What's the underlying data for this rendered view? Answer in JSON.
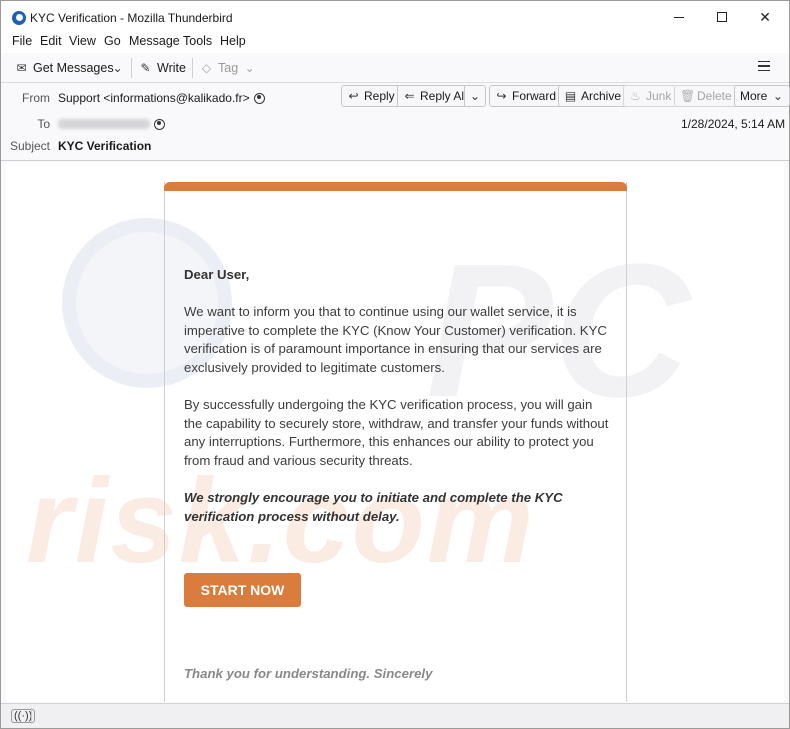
{
  "window": {
    "title": "KYC Verification - Mozilla Thunderbird"
  },
  "menubar": {
    "items": [
      "File",
      "Edit",
      "View",
      "Go",
      "Message",
      "Tools",
      "Help"
    ]
  },
  "toolbar": {
    "get_messages": "Get Messages",
    "write": "Write",
    "tag": "Tag"
  },
  "header": {
    "from_label": "From",
    "from_value": "Support <informations@kalikado.fr>",
    "to_label": "To",
    "subject_label": "Subject",
    "subject_value": "KYC Verification",
    "date": "1/28/2024, 5:14 AM",
    "actions": {
      "reply": "Reply",
      "reply_all": "Reply All",
      "forward": "Forward",
      "archive": "Archive",
      "junk": "Junk",
      "delete": "Delete",
      "more": "More"
    }
  },
  "message": {
    "greeting": "Dear User,",
    "paragraph1": "We want to inform you that to continue using our wallet service, it is imperative to complete the KYC (Know Your Customer) verification. KYC verification is of paramount importance in ensuring that our services are exclusively provided to legitimate customers.",
    "paragraph2": "By successfully undergoing the KYC verification process, you will gain the capability to securely store, withdraw, and transfer your funds without any interruptions. Furthermore, this enhances our ability to protect you from fraud and various security threats.",
    "paragraph3": "We strongly encourage you to initiate and complete the KYC verification process without delay.",
    "button_label": "START NOW",
    "closing": "Thank you for understanding. Sincerely",
    "accent_color": "#d97c3c"
  },
  "watermark": {
    "text": "risk.com"
  }
}
